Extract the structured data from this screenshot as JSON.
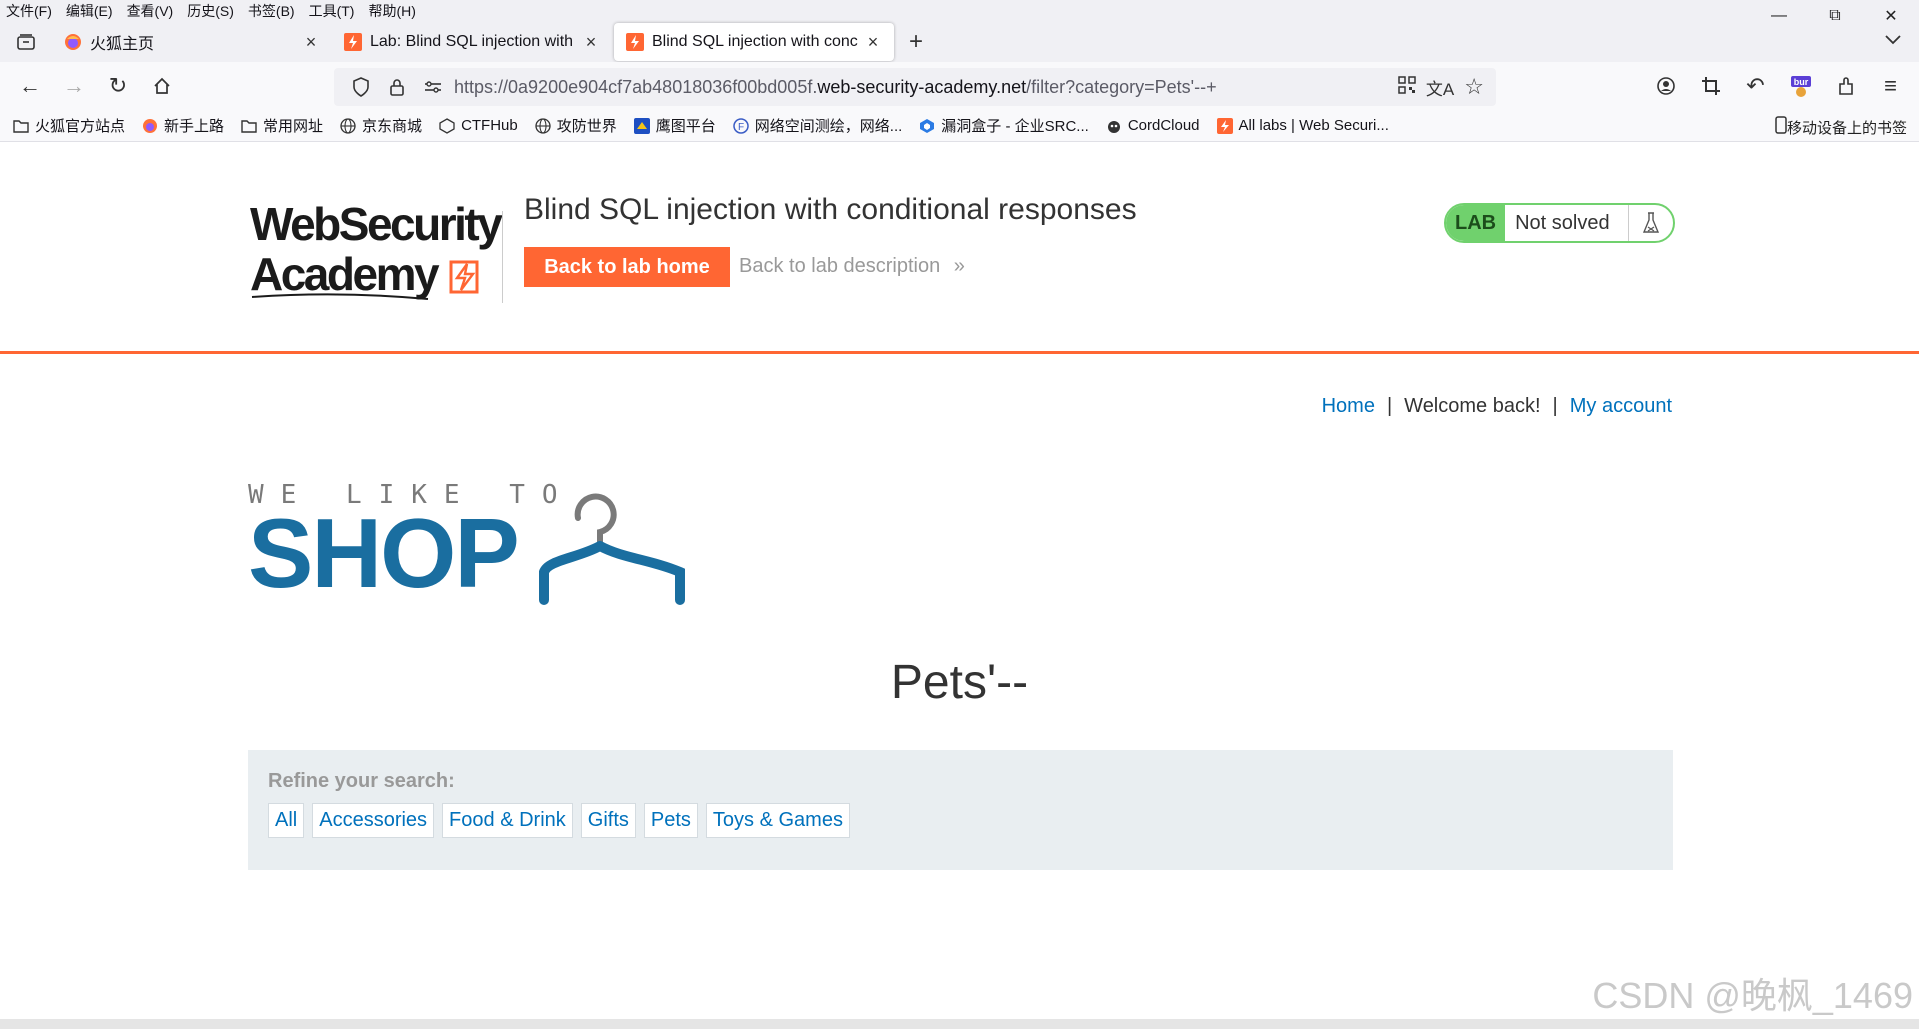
{
  "menubar": {
    "items": [
      "文件(F)",
      "编辑(E)",
      "查看(V)",
      "历史(S)",
      "书签(B)",
      "工具(T)",
      "帮助(H)"
    ]
  },
  "tabs": [
    {
      "title": "火狐主页",
      "favicon": "firefox-icon",
      "active": false
    },
    {
      "title": "Lab: Blind SQL injection with",
      "favicon": "portswigger-icon",
      "active": false
    },
    {
      "title": "Blind SQL injection with conc",
      "favicon": "portswigger-icon",
      "active": true
    }
  ],
  "urlbar": {
    "url_prefix": "https://0a9200e904cf7ab48018036f00bd005f.",
    "url_host": "web-security-academy.net",
    "url_path": "/filter?category=Pets'--+"
  },
  "bookmarks": [
    {
      "label": "火狐官方站点",
      "icon": "folder-icon"
    },
    {
      "label": "新手上路",
      "icon": "firefox-icon"
    },
    {
      "label": "常用网址",
      "icon": "folder-icon"
    },
    {
      "label": "京东商城",
      "icon": "globe-icon"
    },
    {
      "label": "CTFHub",
      "icon": "ctfhub-icon"
    },
    {
      "label": "攻防世界",
      "icon": "globe-icon"
    },
    {
      "label": "鹰图平台",
      "icon": "hunter-icon"
    },
    {
      "label": "网络空间测绘，网络...",
      "icon": "fofa-icon"
    },
    {
      "label": "漏洞盒子 - 企业SRC...",
      "icon": "vulbox-icon"
    },
    {
      "label": "CordCloud",
      "icon": "cordcloud-icon"
    },
    {
      "label": "All labs | Web Securi...",
      "icon": "portswigger-icon"
    }
  ],
  "bookmarks_mobile": "移动设备上的书签",
  "lab": {
    "logo_line1": "WebSecurity",
    "logo_line2": "Academy",
    "title": "Blind SQL injection with conditional responses",
    "back_home": "Back to lab home",
    "back_desc": "Back to lab description",
    "status_tag": "LAB",
    "status_text": "Not solved"
  },
  "topnav": {
    "home": "Home",
    "welcome": "Welcome back!",
    "account": "My account"
  },
  "shop_logo": {
    "tagline": "WE LIKE TO",
    "word": "SHOP"
  },
  "category_heading": "Pets'--",
  "filter": {
    "label": "Refine your search:",
    "links": [
      "All",
      "Accessories",
      "Food & Drink",
      "Gifts",
      "Pets",
      "Toys & Games"
    ]
  },
  "watermark": "CSDN @晚枫_1469",
  "colors": {
    "accent": "#ff6633",
    "link": "#0071bc",
    "lab_green": "#70d16d",
    "shop_blue": "#1a6ea0"
  }
}
